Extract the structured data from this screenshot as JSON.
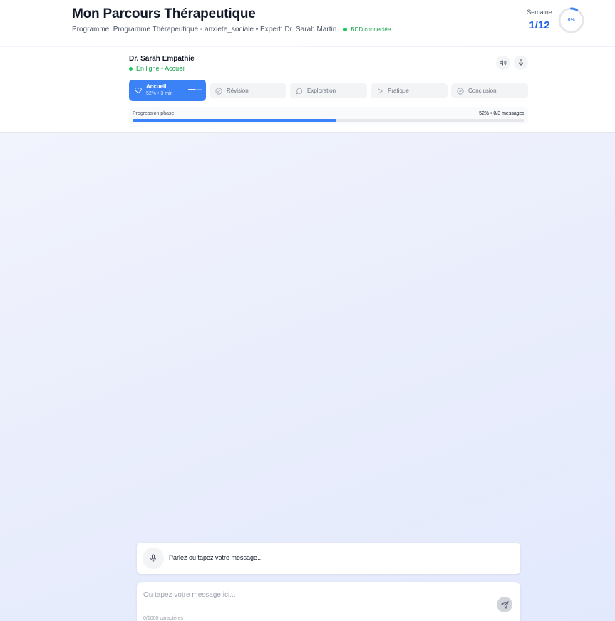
{
  "header": {
    "title": "Mon Parcours Thérapeutique",
    "program_text": "Programme: Programme Thérapeutique - anxiete_sociale • Expert: Dr. Sarah Martin",
    "db_status": "BDD connectée",
    "week_label": "Semaine",
    "week_value": "1/12",
    "overall_progress_label": "8%",
    "overall_progress": 0.08
  },
  "session": {
    "therapist_name": "Dr. Sarah Empathie",
    "status_text": "En ligne • Accueil",
    "phases": [
      {
        "label": "Accueil",
        "meta": "52% • 3 min",
        "active": true,
        "progress": 0.52
      },
      {
        "label": "Révision",
        "active": false
      },
      {
        "label": "Exploration",
        "active": false
      },
      {
        "label": "Pratique",
        "active": false
      },
      {
        "label": "Conclusion",
        "active": false
      }
    ],
    "phase_progress_label": "Progression phase",
    "phase_progress_meta": "52% • 0/3 messages",
    "phase_progress": 0.52
  },
  "input": {
    "voice_prompt": "Parlez ou tapez votre message...",
    "placeholder": "Ou tapez votre message ici...",
    "char_count": "0/1000 caractères"
  },
  "colors": {
    "accent": "#3b82f6",
    "success": "#22c55e"
  }
}
